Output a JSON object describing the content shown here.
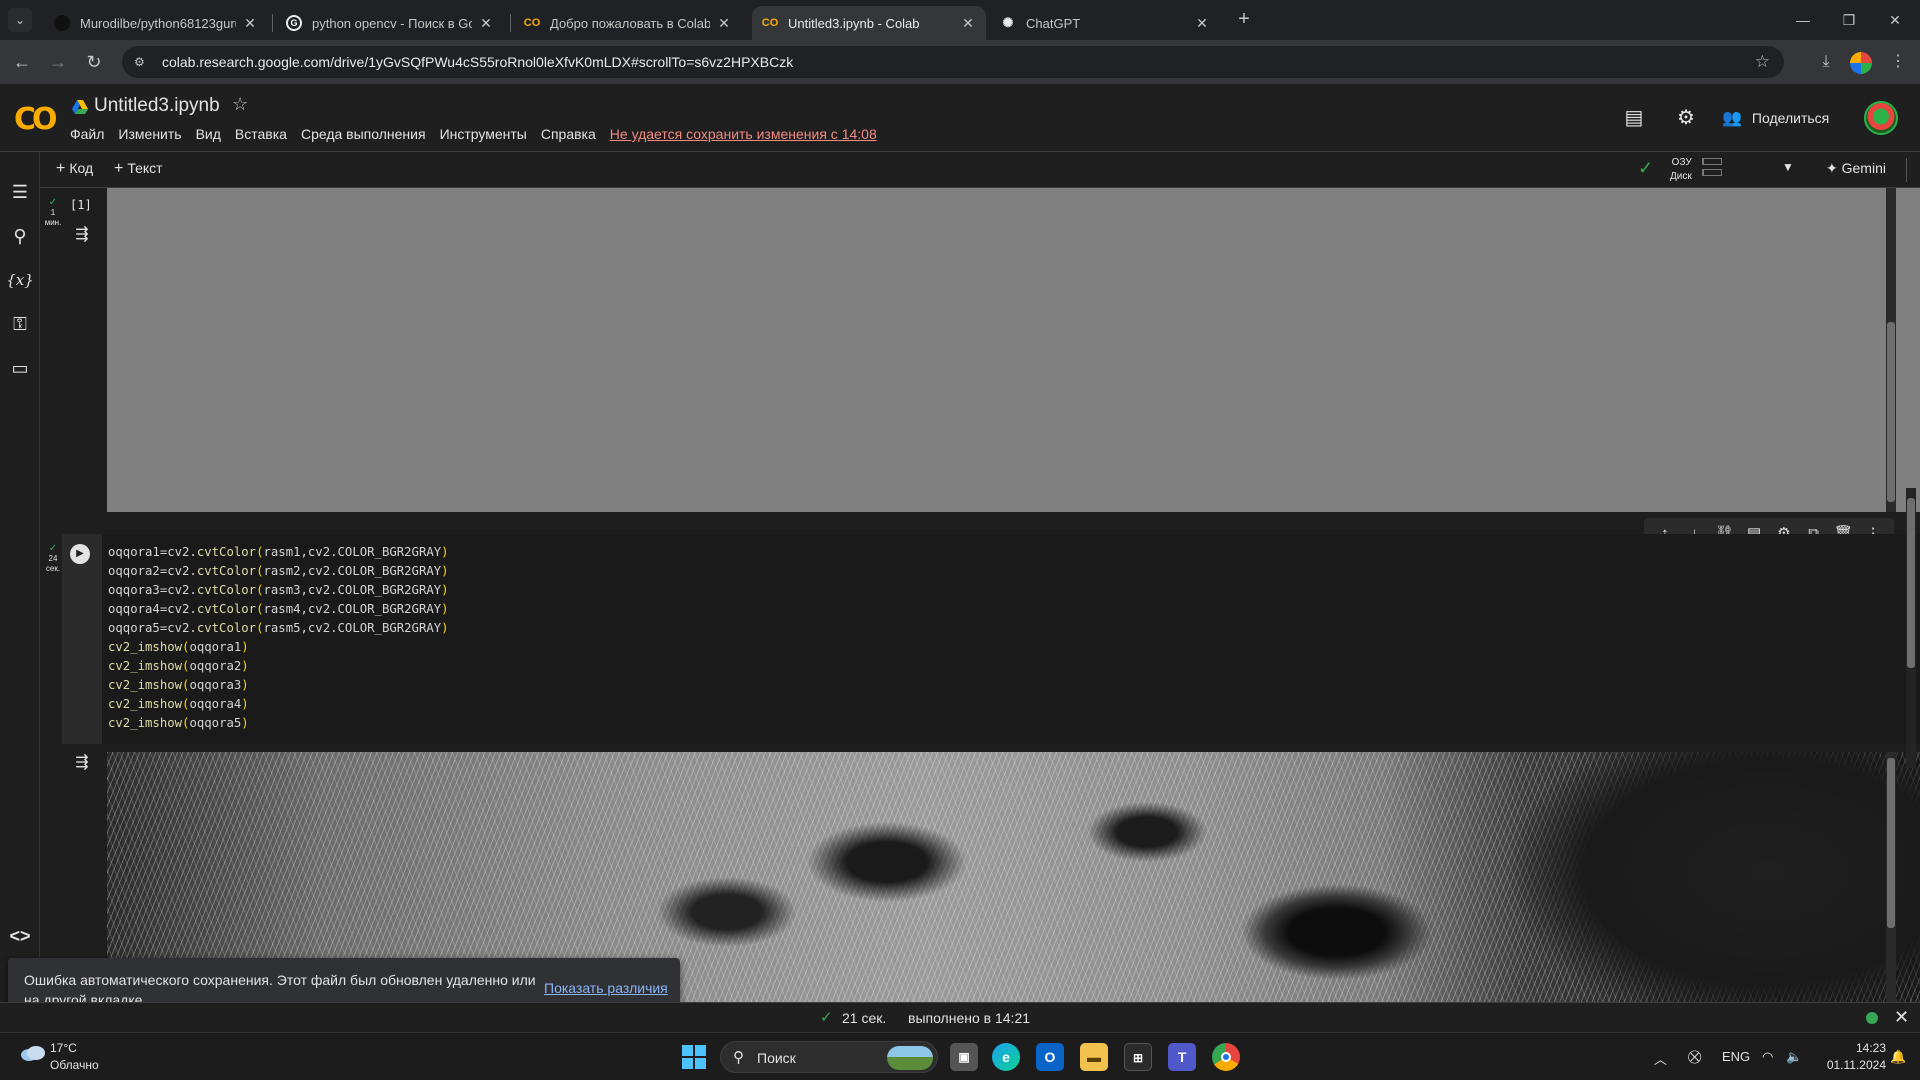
{
  "browser": {
    "tabs": [
      {
        "label": "Murodilbe/python68123guruh",
        "icon": "github-icon"
      },
      {
        "label": "python opencv - Поиск в Google",
        "icon": "google-icon"
      },
      {
        "label": "Добро пожаловать в Colaboratory",
        "icon": "colab-icon"
      },
      {
        "label": "Untitled3.ipynb - Colab",
        "icon": "colab-icon",
        "active": true
      },
      {
        "label": "ChatGPT",
        "icon": "chatgpt-icon"
      }
    ],
    "url": "colab.research.google.com/drive/1yGvSQfPWu4cS55roRnol0leXfvK0mLDX#scrollTo=s6vz2HPXBCzk"
  },
  "colab": {
    "title": "Untitled3.ipynb",
    "menu": [
      "Файл",
      "Изменить",
      "Вид",
      "Вставка",
      "Среда выполнения",
      "Инструменты",
      "Справка"
    ],
    "save_warning": "Не удается сохранить изменения с 14:08",
    "share_label": "Поделиться",
    "toolbar": {
      "add_code": "Код",
      "add_text": "Текст",
      "ram_label": "ОЗУ",
      "disk_label": "Диск",
      "ram_usage": 0.05,
      "disk_usage": 0.05,
      "gemini_label": "Gemini"
    }
  },
  "cells": [
    {
      "exec_count": "[1]",
      "status_line1": "1",
      "status_line2": "мин."
    },
    {
      "status_line1": "24",
      "status_line2": "сек.",
      "code": [
        "oqqora1=cv2.cvtColor(rasm1,cv2.COLOR_BGR2GRAY)",
        "oqqora2=cv2.cvtColor(rasm2,cv2.COLOR_BGR2GRAY)",
        "oqqora3=cv2.cvtColor(rasm3,cv2.COLOR_BGR2GRAY)",
        "oqqora4=cv2.cvtColor(rasm4,cv2.COLOR_BGR2GRAY)",
        "oqqora5=cv2.cvtColor(rasm5,cv2.COLOR_BGR2GRAY)",
        "cv2_imshow(oqqora1)",
        "cv2_imshow(oqqora2)",
        "cv2_imshow(oqqora3)",
        "cv2_imshow(oqqora4)",
        "cv2_imshow(oqqora5)"
      ]
    }
  ],
  "toast": {
    "message": "Ошибка автоматического сохранения. Этот файл был обновлен удаленно или на другой вкладке.",
    "link": "Показать различия"
  },
  "status": {
    "duration": "21 сек.",
    "executed": "выполнено в 14:21"
  },
  "taskbar": {
    "weather_temp": "17°C",
    "weather_cond": "Облачно",
    "search_placeholder": "Поиск",
    "lang": "ENG",
    "time": "14:23",
    "date": "01.11.2024"
  }
}
